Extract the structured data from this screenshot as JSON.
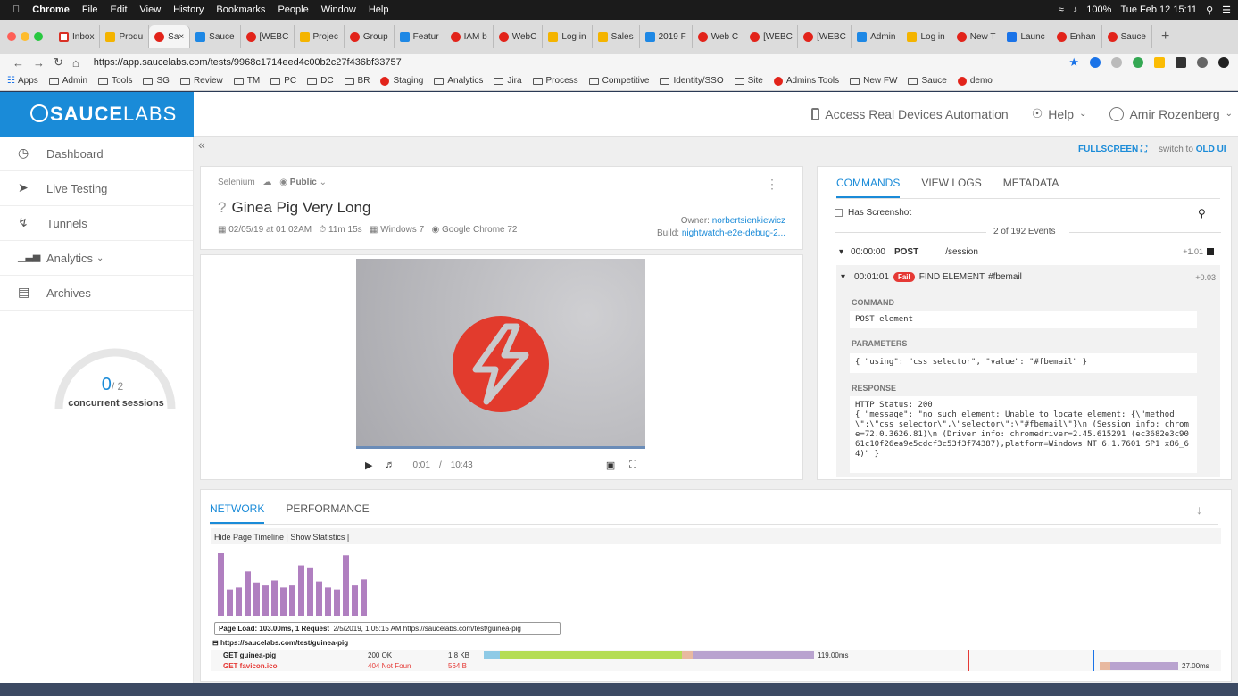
{
  "menubar": {
    "apple": "",
    "app": "Chrome",
    "items": [
      "File",
      "Edit",
      "View",
      "History",
      "Bookmarks",
      "People",
      "Window",
      "Help"
    ],
    "status": "100%",
    "clock": "Tue Feb 12  15:11"
  },
  "tabs": [
    {
      "label": "Inbox",
      "icon": "gmail"
    },
    {
      "label": "Produ",
      "icon": "slides"
    },
    {
      "label": "Sa",
      "icon": "sauce",
      "active": true
    },
    {
      "label": "Sauce",
      "icon": "calendar"
    },
    {
      "label": "[WEBC",
      "icon": "sauce"
    },
    {
      "label": "Projec",
      "icon": "drive"
    },
    {
      "label": "Group",
      "icon": "sauce"
    },
    {
      "label": "Featur",
      "icon": "trello"
    },
    {
      "label": "IAM b",
      "icon": "sauce"
    },
    {
      "label": "WebC",
      "icon": "sauce"
    },
    {
      "label": "Log in",
      "icon": "slack"
    },
    {
      "label": "Sales",
      "icon": "slides"
    },
    {
      "label": "2019 F",
      "icon": "docs"
    },
    {
      "label": "Web C",
      "icon": "sauce"
    },
    {
      "label": "[WEBC",
      "icon": "sauce"
    },
    {
      "label": "[WEBC",
      "icon": "sauce"
    },
    {
      "label": "Admin",
      "icon": "docs"
    },
    {
      "label": "Log in",
      "icon": "slack"
    },
    {
      "label": "New T",
      "icon": "sauce"
    },
    {
      "label": "Launc",
      "icon": "launch"
    },
    {
      "label": "Enhan",
      "icon": "sauce"
    },
    {
      "label": "Sauce",
      "icon": "sauce"
    }
  ],
  "address": {
    "url": "https://app.saucelabs.com/tests/9968c1714eed4c00b2c27f436bf33757"
  },
  "bookmarks": [
    "Apps",
    "Admin",
    "Tools",
    "SG",
    "Review",
    "TM",
    "PC",
    "DC",
    "BR",
    "Staging",
    "Analytics",
    "Jira",
    "Process",
    "Competitive",
    "Identity/SSO",
    "Site",
    "Admins Tools",
    "New FW",
    "Sauce",
    "demo"
  ],
  "brand": {
    "bold": "SAUCE",
    "thin": "LABS",
    "color": "#1a8bd8"
  },
  "topbar": {
    "devices": "Access Real Devices Automation",
    "help": "Help",
    "user": "Amir Rozenberg"
  },
  "sidebar": {
    "items": [
      "Dashboard",
      "Live Testing",
      "Tunnels",
      "Analytics",
      "Archives"
    ]
  },
  "concurrency": {
    "value": "0",
    "total": "/ 2",
    "label": "concurrent sessions",
    "fraction": 0
  },
  "links": {
    "fullscreen": "FULLSCREEN",
    "switch_prefix": "switch to",
    "switch_link": "OLD UI"
  },
  "test": {
    "framework": "Selenium",
    "visibility": "Public",
    "status_mark": "?",
    "title": "Ginea Pig Very Long",
    "date": "02/05/19 at 01:02AM",
    "duration": "11m 15s",
    "os": "Windows 7",
    "browser": "Google Chrome 72",
    "owner_label": "Owner:",
    "owner": "norbertsienkiewicz",
    "build_label": "Build:",
    "build": "nightwatch-e2e-debug-2..."
  },
  "video": {
    "current": "0:01",
    "sep": "/",
    "total": "10:43",
    "progress": 0.0016
  },
  "commands": {
    "tabs": [
      "COMMANDS",
      "VIEW LOGS",
      "METADATA"
    ],
    "has_screenshot": "Has Screenshot",
    "events": "2 of 192 Events",
    "row1": {
      "time": "00:00:00",
      "method": "POST",
      "path": "/session",
      "delta": "+1.01"
    },
    "row2": {
      "time": "00:01:01",
      "badge": "Fail",
      "method": "FIND ELEMENT",
      "selector": "#fbemail",
      "delta": "+0.03"
    },
    "command_label": "COMMAND",
    "command": "POST element",
    "params_label": "PARAMETERS",
    "params": "{ \"using\": \"css selector\", \"value\": \"#fbemail\" }",
    "response_label": "RESPONSE",
    "response": "HTTP Status: 200\n{ \"message\": \"no such element: Unable to locate element: {\\\"method\\\":\\\"css selector\\\",\\\"selector\\\":\\\"#fbemail\\\"}\\n (Session info: chrome=72.0.3626.81)\\n (Driver info: chromedriver=2.45.615291 (ec3682e3c9061c10f26ea9e5cdcf3c53f3f74387),platform=Windows NT 6.1.7601 SP1 x86_64)\" }"
  },
  "network": {
    "tabs": [
      "NETWORK",
      "PERFORMANCE"
    ],
    "timeline_links": "Hide Page Timeline  |  Show Statistics  |",
    "bars": [
      62,
      26,
      28,
      44,
      33,
      30,
      35,
      28,
      30,
      50,
      48,
      34,
      28,
      26,
      60,
      30,
      36
    ],
    "bar_color": "#b07fc0",
    "tooltip_bold": "Page Load: 103.00ms, 1 Request",
    "tooltip_rest": "2/5/2019, 1:05:15 AM  https://saucelabs.com/test/guinea-pig",
    "host": "https://saucelabs.com/test/guinea-pig",
    "requests": [
      {
        "name": "GET guinea-pig",
        "status": "200 OK",
        "size": "1.8 KB",
        "time": "119.00ms"
      },
      {
        "name": "GET favicon.ico",
        "status": "404 Not Foun",
        "size": "564 B",
        "time": "27.00ms"
      }
    ]
  }
}
